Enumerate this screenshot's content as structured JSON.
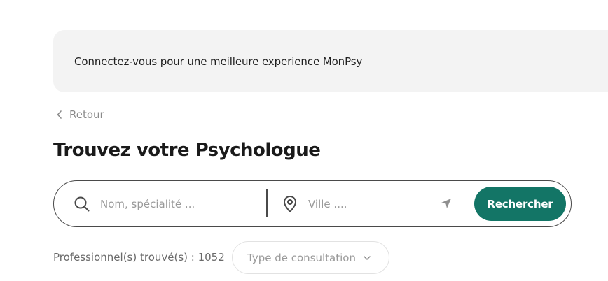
{
  "banner": {
    "text": "Connectez-vous pour une meilleure experience MonPsy"
  },
  "nav": {
    "back_label": "Retour"
  },
  "page": {
    "title": "Trouvez votre Psychologue"
  },
  "search": {
    "name_placeholder": "Nom, spécialité ...",
    "name_value": "",
    "city_placeholder": "Ville ....",
    "city_value": "",
    "button_label": "Rechercher",
    "icons": [
      "search-icon",
      "location-pin-icon",
      "geolocate-icon"
    ]
  },
  "results": {
    "count_text": "Professionnel(s) trouvé(s) : 1052",
    "filter_label": "Type de consultation"
  },
  "colors": {
    "accent": "#137566",
    "banner_bg": "#f3f3f3",
    "border": "#4a4a4a",
    "muted_text": "#9a9a9a"
  }
}
